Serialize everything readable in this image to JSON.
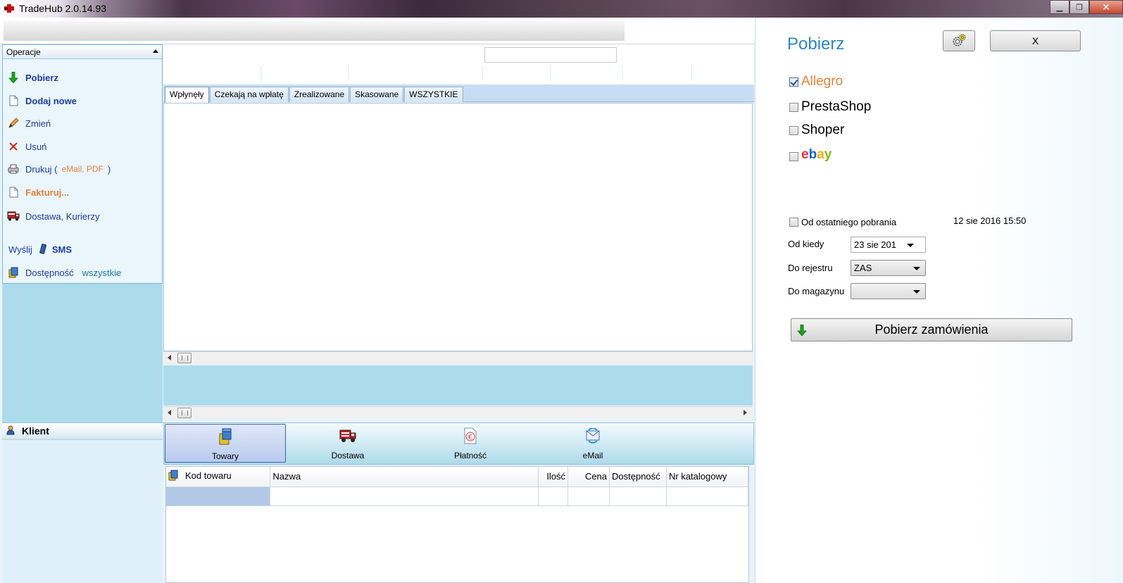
{
  "window": {
    "title": "TradeHub 2.0.14.93",
    "minimize_glyph": "▁",
    "maximize_glyph": "❐",
    "close_glyph": "✕"
  },
  "operations": {
    "header": "Operacje",
    "items": [
      {
        "label": "Pobierz",
        "icon": "green-down-arrow-icon"
      },
      {
        "label": "Dodaj nowe",
        "icon": "new-document-icon"
      },
      {
        "label": "Zmień",
        "icon": "pencil-icon"
      },
      {
        "label": "Usuń",
        "icon": "red-x-icon"
      },
      {
        "label": "Drukuj (",
        "sub": "eMail, PDF",
        "tail": ")",
        "icon": "printer-icon"
      },
      {
        "label": "Fakturuj...",
        "icon": "invoice-document-icon"
      },
      {
        "label": "Dostawa, Kurierzy",
        "icon": "truck-icon"
      }
    ],
    "send_prefix": "Wyślij",
    "sms_label": "SMS",
    "availability_label": "Dostępność",
    "availability_value": "wszystkie"
  },
  "client": {
    "header": "Klient"
  },
  "order_tabs": [
    "Wpłynęły",
    "Czekają na wpłatę",
    "Zrealizowane",
    "Skasowane",
    "WSZYSTKIE"
  ],
  "bottom_tabs": [
    {
      "label": "Towary",
      "icon": "boxes-icon"
    },
    {
      "label": "Dostawa",
      "icon": "truck-icon"
    },
    {
      "label": "Płatność",
      "icon": "euro-document-icon"
    },
    {
      "label": "eMail",
      "icon": "email-sync-icon"
    }
  ],
  "items_table": {
    "columns": [
      "Kod towaru",
      "Nazwa",
      "Ilość",
      "Cena",
      "Dostępność",
      "Nr katalogowy"
    ]
  },
  "download_panel": {
    "title": "Pobierz",
    "close_label": "X",
    "sources": [
      {
        "label": "Allegro",
        "checked": true
      },
      {
        "label": "PrestaShop",
        "checked": false
      },
      {
        "label": "Shoper",
        "checked": false
      },
      {
        "label": "ebay",
        "checked": false
      }
    ],
    "ebay_colors": [
      "#e53238",
      "#0064d2",
      "#f5af02",
      "#86b817"
    ],
    "since_last_label": "Od ostatniego pobrania",
    "last_download_date": "12 sie 2016   15:50",
    "from_label": "Od kiedy",
    "from_value": "23  sie  201",
    "register_label": "Do rejestru",
    "register_value": "ZAS",
    "warehouse_label": "Do magazynu",
    "warehouse_value": "",
    "fetch_button": "Pobierz zamówienia"
  },
  "colors": {
    "accent": "#2c86c2",
    "panel_blue": "#acdcec",
    "allegro_orange": "#e8833a",
    "link_blue": "#1c3ba0"
  }
}
